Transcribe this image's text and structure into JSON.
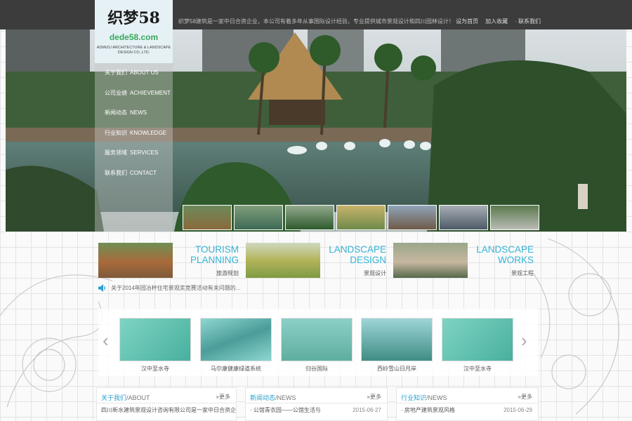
{
  "topbar": {
    "notice": "织梦58建筑是一家中日合资企业，本公司有着多年从事国际设计经验，专业提供城市景观设计和四川园林设计！",
    "links": [
      "设为首页",
      "加入收藏",
      "· 联系我们"
    ]
  },
  "logo": {
    "name_cn": "织梦58",
    "domain": "dede58.com",
    "name_en": "ADMIZU ARCHITECTURE & LANDSCAPE DESIGN CO.,LTD."
  },
  "nav": [
    {
      "cn": "关于我们",
      "en": "ABOUT US"
    },
    {
      "cn": "公司业绩",
      "en": "ACHIEVEMENT"
    },
    {
      "cn": "新闻动态",
      "en": "NEWS"
    },
    {
      "cn": "行业知识",
      "en": "KNOWLEDGE"
    },
    {
      "cn": "服务领域",
      "en": "SERVICES"
    },
    {
      "cn": "联系我们",
      "en": "CONTACT"
    }
  ],
  "services": [
    {
      "title": "TOURISM PLANNING",
      "sub": "旅游规划"
    },
    {
      "title": "LANDSCAPE DESIGN",
      "sub": "景观设计"
    },
    {
      "title": "LANDSCAPE WORKS",
      "sub": "景观工程"
    }
  ],
  "scroll_news": "关于2014年园冶杯住宅景观奖竞赛活动有关问题的...",
  "cases": [
    {
      "caption": "汉中至水寺"
    },
    {
      "caption": "马尔康健康绿道系统"
    },
    {
      "caption": "归谷国际"
    },
    {
      "caption": "西岭雪山日月岸"
    },
    {
      "caption": "汉中至水寺"
    }
  ],
  "carousel": {
    "prev": "‹",
    "next": "›"
  },
  "boxes": [
    {
      "title_cn": "关于我们",
      "title_en": "/ABOUT",
      "more": "»更多",
      "line": "四川新水建筑景观设计咨询有限公司是一家中日合资企",
      "date": ""
    },
    {
      "title_cn": "新闻动态",
      "title_en": "/NEWS",
      "more": "»更多",
      "line": "· 公馆青衣园——公馆生活与",
      "date": "2015-06-27"
    },
    {
      "title_cn": "行业知识",
      "title_en": "/NEWS",
      "more": "»更多",
      "line": "· 房地产建筑景观风格",
      "date": "2015-06-29"
    }
  ],
  "colors": {
    "accent": "#34b4d6",
    "topbar": "#3c3c3c",
    "logo_bg": "#e6f1f6",
    "logo_green": "#3aa85c"
  }
}
